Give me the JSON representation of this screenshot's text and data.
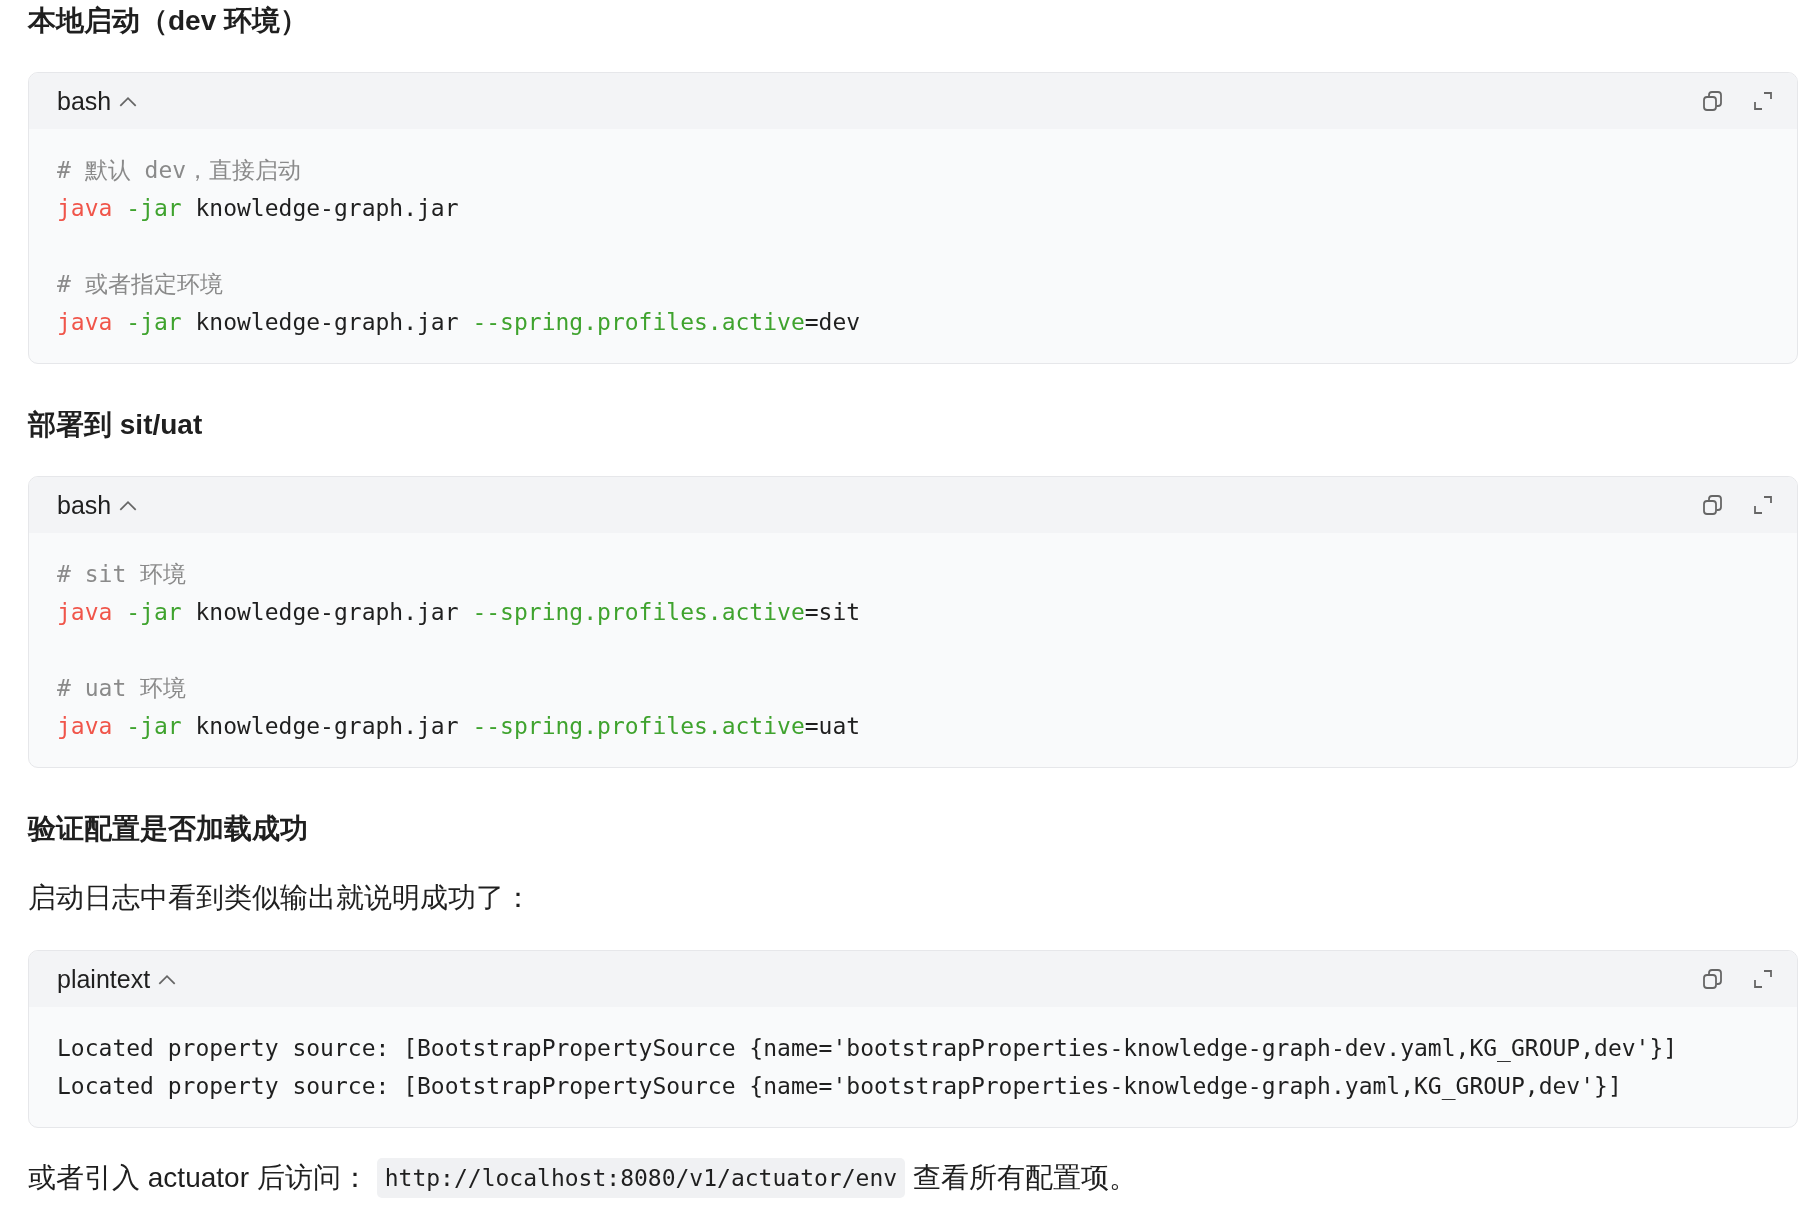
{
  "sections": [
    {
      "heading": "本地启动（dev 环境）",
      "blocks": [
        {
          "kind": "code",
          "language": "bash",
          "expanded": true,
          "groups": [
            [
              [
                {
                  "kind": "comment",
                  "text": "# 默认 dev，直接启动"
                }
              ],
              [
                {
                  "kind": "command",
                  "text": "java"
                },
                {
                  "kind": "flag",
                  "text": "-jar"
                },
                {
                  "kind": "plain",
                  "text": "knowledge-graph.jar"
                }
              ]
            ],
            [
              [
                {
                  "kind": "comment",
                  "text": "# 或者指定环境"
                }
              ],
              [
                {
                  "kind": "command",
                  "text": "java"
                },
                {
                  "kind": "flag",
                  "text": "-jar"
                },
                {
                  "kind": "plain",
                  "text": "knowledge-graph.jar"
                },
                {
                  "kind": "flag",
                  "text": "--spring.profiles.active"
                },
                {
                  "kind": "value",
                  "text": "=dev"
                }
              ]
            ]
          ]
        }
      ]
    },
    {
      "heading": "部署到 sit/uat",
      "blocks": [
        {
          "kind": "code",
          "language": "bash",
          "expanded": true,
          "groups": [
            [
              [
                {
                  "kind": "comment",
                  "text": "# sit 环境"
                }
              ],
              [
                {
                  "kind": "command",
                  "text": "java"
                },
                {
                  "kind": "flag",
                  "text": "-jar"
                },
                {
                  "kind": "plain",
                  "text": "knowledge-graph.jar"
                },
                {
                  "kind": "flag",
                  "text": "--spring.profiles.active"
                },
                {
                  "kind": "value",
                  "text": "=sit"
                }
              ]
            ],
            [
              [
                {
                  "kind": "comment",
                  "text": "# uat 环境"
                }
              ],
              [
                {
                  "kind": "command",
                  "text": "java"
                },
                {
                  "kind": "flag",
                  "text": "-jar"
                },
                {
                  "kind": "plain",
                  "text": "knowledge-graph.jar"
                },
                {
                  "kind": "flag",
                  "text": "--spring.profiles.active"
                },
                {
                  "kind": "value",
                  "text": "=uat"
                }
              ]
            ]
          ]
        }
      ]
    },
    {
      "heading": "验证配置是否加载成功",
      "blocks": [
        {
          "kind": "paragraph",
          "text": "启动日志中看到类似输出就说明成功了："
        },
        {
          "kind": "code",
          "language": "plaintext",
          "expanded": true,
          "groups": [
            [
              [
                {
                  "kind": "plain",
                  "text": "Located property source: [BootstrapPropertySource {name='bootstrapProperties-knowledge-graph-dev.yaml,KG_GROUP,dev'}]"
                }
              ],
              [
                {
                  "kind": "plain",
                  "text": "Located property source: [BootstrapPropertySource {name='bootstrapProperties-knowledge-graph.yaml,KG_GROUP,dev'}]"
                }
              ]
            ]
          ]
        },
        {
          "kind": "inline",
          "parts": [
            {
              "kind": "text",
              "text": "或者引入 actuator 后访问："
            },
            {
              "kind": "code",
              "text": "http://localhost:8080/v1/actuator/env"
            },
            {
              "kind": "text",
              "text": "查看所有配置项。"
            }
          ]
        }
      ]
    }
  ]
}
